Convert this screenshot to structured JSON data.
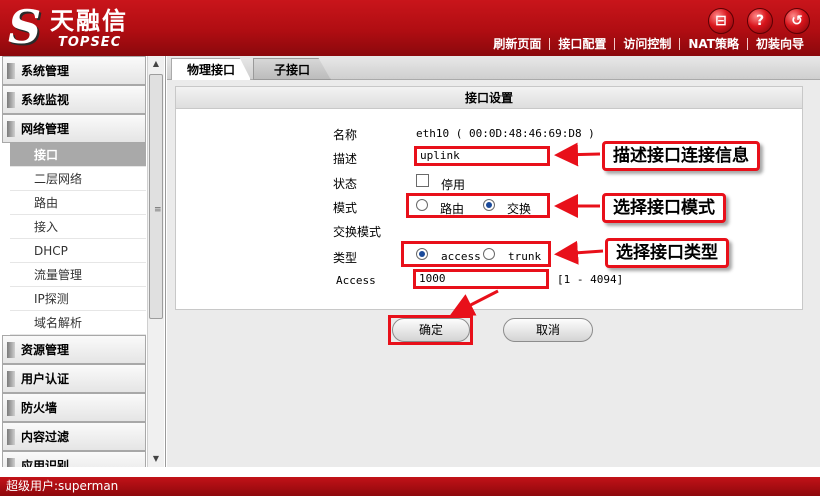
{
  "brand": {
    "name_cn": "天融信",
    "name_en": "TOPSEC",
    "logo_letter": "S"
  },
  "header_icons": [
    {
      "name": "save-icon",
      "glyph": "⊟"
    },
    {
      "name": "help-icon",
      "glyph": "?"
    },
    {
      "name": "logout-icon",
      "glyph": "↺"
    }
  ],
  "header_nav": [
    "刷新页面",
    "接口配置",
    "访问控制",
    "NAT策略",
    "初装向导"
  ],
  "sidebar": {
    "groups_before": [
      "系统管理",
      "系统监视"
    ],
    "active_group": "网络管理",
    "items": [
      "接口",
      "二层网络",
      "路由",
      "接入",
      "DHCP",
      "流量管理",
      "IP探测",
      "域名解析"
    ],
    "active_item": "接口",
    "groups_after": [
      "资源管理",
      "用户认证",
      "防火墙",
      "内容过滤",
      "应用识别"
    ]
  },
  "tabs": {
    "physical": "物理接口",
    "sub": "子接口"
  },
  "form": {
    "title": "接口设置",
    "name_label": "名称",
    "name_value": "eth10  ( 00:0D:48:46:69:D8 )",
    "desc_label": "描述",
    "desc_value": "uplink",
    "status_label": "状态",
    "status_option": "停用",
    "mode_label": "模式",
    "mode_options": [
      "路由",
      "交换"
    ],
    "mode_selected": "交换",
    "switch_mode_label": "交换模式",
    "type_label": "类型",
    "type_options": [
      "access",
      "trunk"
    ],
    "type_selected": "access",
    "access_label": "Access",
    "access_value": "1000",
    "access_range": "[1 - 4094]",
    "ok_label": "确定",
    "cancel_label": "取消"
  },
  "callouts": {
    "describe": "描述接口连接信息",
    "mode": "选择接口模式",
    "type": "选择接口类型"
  },
  "status": {
    "user_label": "超级用户:superman"
  },
  "colors": {
    "brand_red": "#c21218",
    "annotation_red": "#e8101a"
  }
}
